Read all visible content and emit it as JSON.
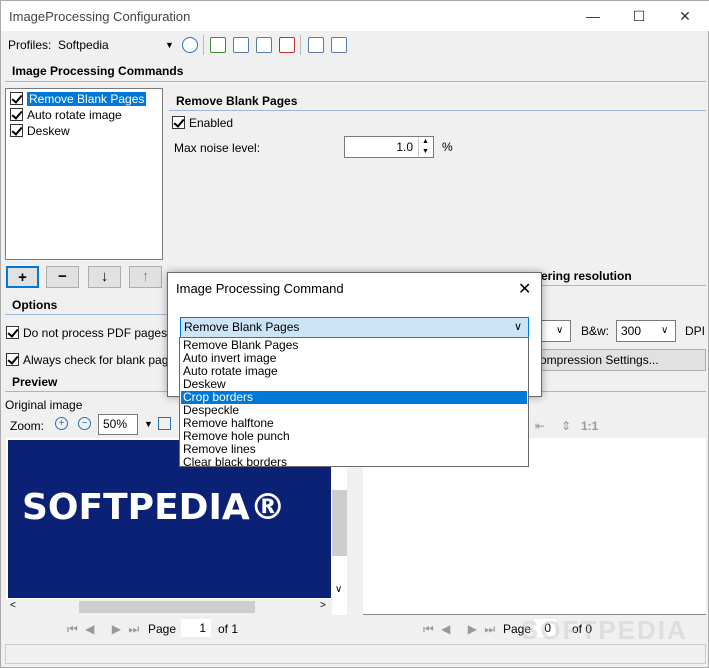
{
  "window": {
    "title": "ImageProcessing Configuration",
    "min_glyph": "—",
    "max_glyph": "☐",
    "close_glyph": "✕"
  },
  "profiles": {
    "label": "Profiles:",
    "value": "Softpedia"
  },
  "commands": {
    "heading": "Image Processing Commands",
    "items": [
      {
        "label": "Remove Blank Pages",
        "checked": true,
        "selected": true
      },
      {
        "label": "Auto rotate image",
        "checked": true,
        "selected": false
      },
      {
        "label": "Deskew",
        "checked": true,
        "selected": false
      }
    ]
  },
  "detail": {
    "heading": "Remove Blank Pages",
    "enabled_label": "Enabled",
    "noise_label": "Max noise level:",
    "noise_value": "1.0",
    "noise_unit": "%"
  },
  "buttons": {
    "add": "+",
    "remove": "−",
    "down": "↓",
    "up": "↑"
  },
  "options": {
    "heading": "Options",
    "opt1": "Do not process PDF pages if c",
    "opt2": "Always check for blank pages i"
  },
  "pdf": {
    "heading_partial": "PDF - Rendering resolution",
    "bw_label": "B&w:",
    "bw_value": "300",
    "dpi_label": "DPI",
    "compression_btn": "ompression Settings..."
  },
  "preview": {
    "heading": "Preview",
    "original_label": "Original image",
    "zoom_label": "Zoom:",
    "zoom_value": "50%",
    "logo_text": "SOFTPEDIA®",
    "page_label": "Page",
    "left_page": "1",
    "left_of": "of 1",
    "right_page": "0",
    "right_of": "of 0",
    "ratio_label": "1:1",
    "watermark": "SOFTPEDIA"
  },
  "modal": {
    "title": "Image Processing Command",
    "selected_value": "Remove Blank Pages",
    "options": [
      "Remove Blank Pages",
      "Auto invert image",
      "Auto rotate image",
      "Deskew",
      "Crop borders",
      "Despeckle",
      "Remove halftone",
      "Remove hole punch",
      "Remove lines",
      "Clear black borders"
    ],
    "highlighted": "Crop borders"
  }
}
